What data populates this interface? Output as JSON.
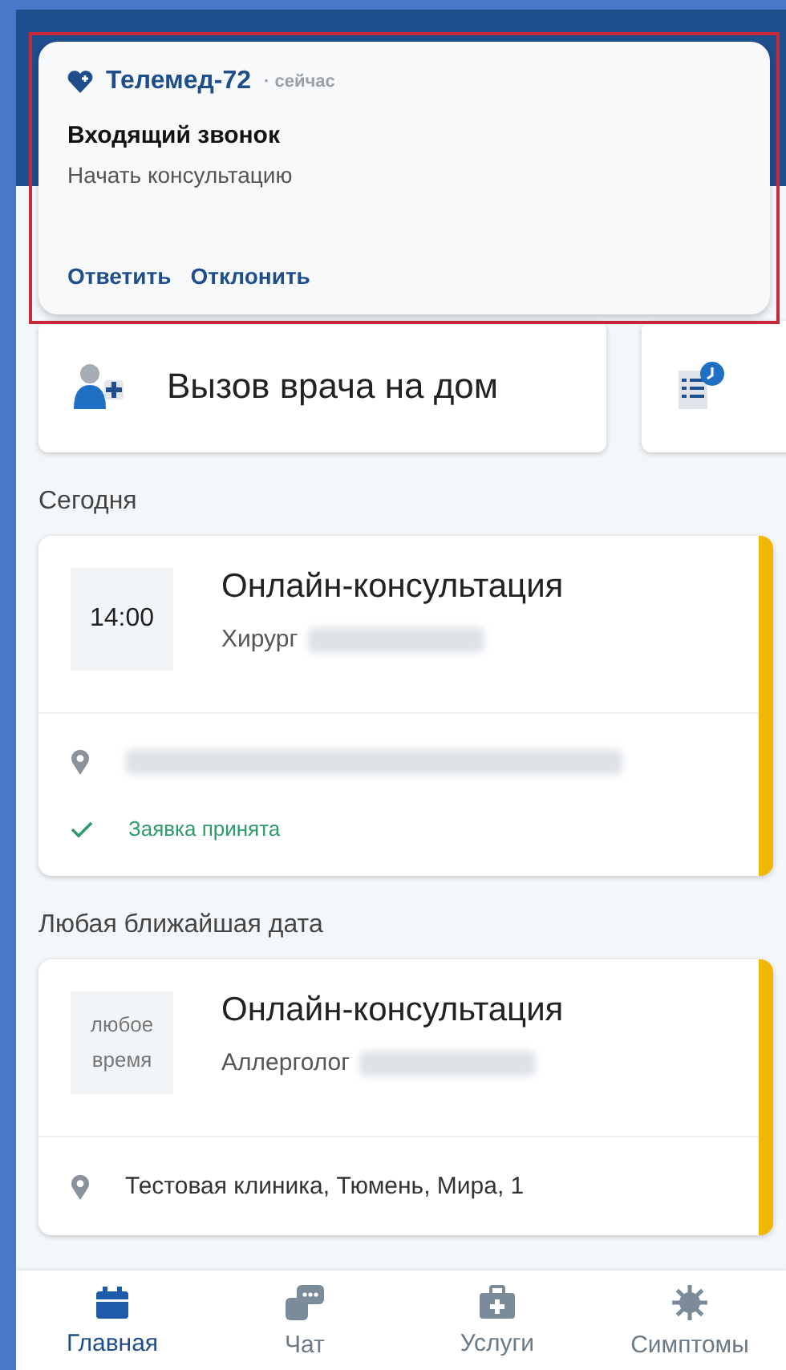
{
  "notification": {
    "app": "Телемед-72",
    "time": "· сейчас",
    "title": "Входящий звонок",
    "body": "Начать консультацию",
    "actions": [
      "Ответить",
      "Отклонить"
    ]
  },
  "quick_actions": [
    {
      "kind": "house_call",
      "label": "Вызов врача на дом"
    },
    {
      "kind": "schedule"
    }
  ],
  "sections": [
    {
      "title": "Сегодня",
      "appointments": [
        {
          "time": "14:00",
          "type": "Онлайн-консультация",
          "specialty": "Хирург",
          "status": "Заявка принята"
        }
      ]
    },
    {
      "title": "Любая ближайшая дата",
      "appointments": [
        {
          "time": "любое время",
          "type": "Онлайн-консультация",
          "specialty": "Аллерголог",
          "address": "Тестовая клиника, Тюмень, Мира, 1"
        }
      ]
    }
  ],
  "nav": [
    {
      "kind": "calendar",
      "label": "Главная",
      "selected": true
    },
    {
      "kind": "chat",
      "label": "Чат",
      "selected": false
    },
    {
      "kind": "services",
      "label": "Услуги",
      "selected": false
    },
    {
      "kind": "symptoms",
      "label": "Симптомы",
      "selected": false
    }
  ]
}
